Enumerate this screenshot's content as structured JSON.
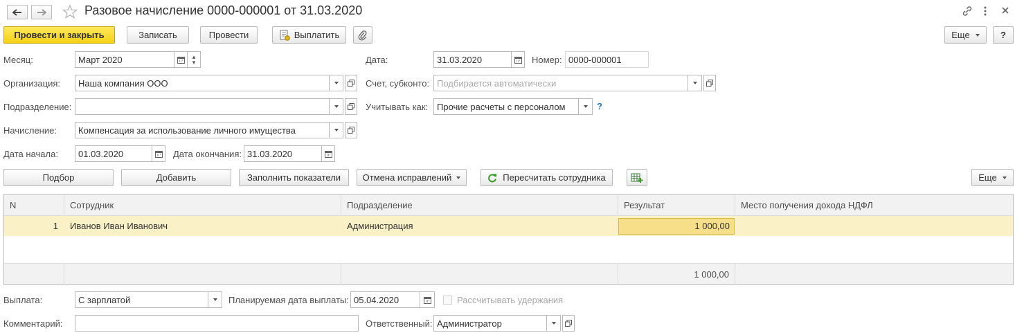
{
  "header": {
    "title": "Разовое начисление 0000-000001 от 31.03.2020"
  },
  "toolbar": {
    "post_close": "Провести и закрыть",
    "save": "Записать",
    "post": "Провести",
    "pay": "Выплатить",
    "more": "Еще",
    "help": "?"
  },
  "form": {
    "month_label": "Месяц:",
    "month_value": "Март 2020",
    "date_label": "Дата:",
    "date_value": "31.03.2020",
    "number_label": "Номер:",
    "number_value": "0000-000001",
    "org_label": "Организация:",
    "org_value": "Наша компания ООО",
    "account_label": "Счет, субконто:",
    "account_placeholder": "Подбирается автоматически",
    "dept_label": "Подразделение:",
    "dept_value": "",
    "account_as_label": "Учитывать как:",
    "account_as_value": "Прочие расчеты с персоналом",
    "accrual_label": "Начисление:",
    "accrual_value": "Компенсация за использование личного имущества",
    "start_label": "Дата начала:",
    "start_value": "01.03.2020",
    "end_label": "Дата окончания:",
    "end_value": "31.03.2020"
  },
  "table_toolbar": {
    "pick": "Подбор",
    "add": "Добавить",
    "fill": "Заполнить показатели",
    "cancel_fix": "Отмена исправлений",
    "recalc": "Пересчитать сотрудника",
    "more": "Еще"
  },
  "table": {
    "columns": [
      "N",
      "Сотрудник",
      "Подразделение",
      "Результат",
      "Место получения дохода НДФЛ"
    ],
    "rows": [
      {
        "n": "1",
        "employee": "Иванов Иван Иванович",
        "dept": "Администрация",
        "result": "1 000,00",
        "place": ""
      }
    ],
    "total_result": "1 000,00"
  },
  "footer": {
    "payment_label": "Выплата:",
    "payment_value": "С зарплатой",
    "planned_label": "Планируемая дата выплаты:",
    "planned_value": "05.04.2020",
    "deductions_label": "Рассчитывать удержания",
    "comment_label": "Комментарий:",
    "comment_value": "",
    "responsible_label": "Ответственный:",
    "responsible_value": "Администратор"
  },
  "colors": {
    "primary_button": "#f5d214",
    "selected_row": "#fbf1c7",
    "help_accent": "#2a7ab0"
  }
}
